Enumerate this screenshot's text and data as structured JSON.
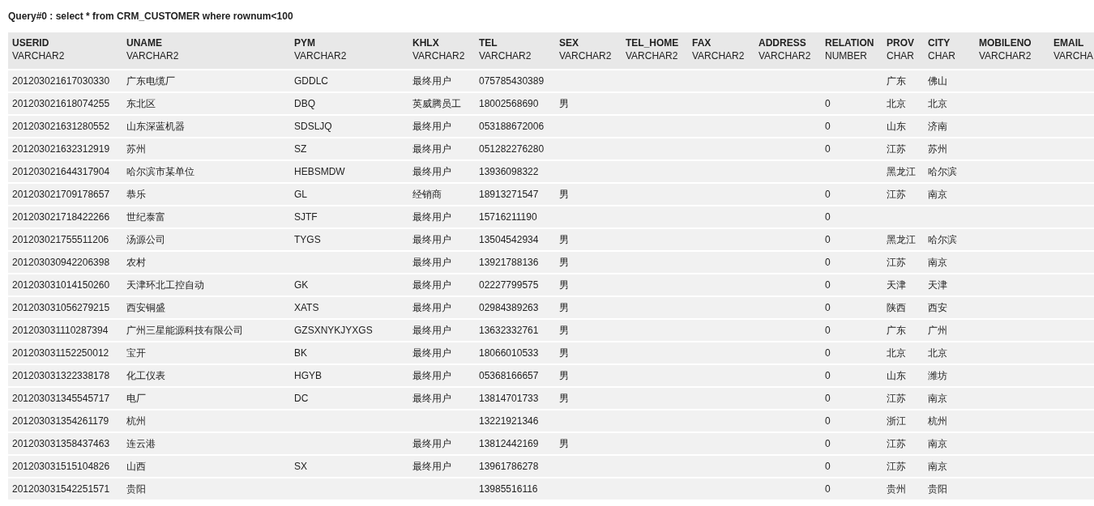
{
  "query_title": "Query#0 : select * from CRM_CUSTOMER where rownum<100",
  "table": {
    "columns": [
      {
        "name": "USERID",
        "type": "VARCHAR2"
      },
      {
        "name": "UNAME",
        "type": "VARCHAR2"
      },
      {
        "name": "PYM",
        "type": "VARCHAR2"
      },
      {
        "name": "KHLX",
        "type": "VARCHAR2"
      },
      {
        "name": "TEL",
        "type": "VARCHAR2"
      },
      {
        "name": "SEX",
        "type": "VARCHAR2"
      },
      {
        "name": "TEL_HOME",
        "type": "VARCHAR2"
      },
      {
        "name": "FAX",
        "type": "VARCHAR2"
      },
      {
        "name": "ADDRESS",
        "type": "VARCHAR2"
      },
      {
        "name": "RELATION",
        "type": "NUMBER"
      },
      {
        "name": "PROV",
        "type": "CHAR"
      },
      {
        "name": "CITY",
        "type": "CHAR"
      },
      {
        "name": "MOBILENO",
        "type": "VARCHAR2"
      },
      {
        "name": "EMAIL",
        "type": "VARCHA"
      }
    ],
    "rows": [
      {
        "userid": "201203021617030330",
        "uname": "广东电缆厂",
        "pym": "GDDLC",
        "khlx": "最终用户",
        "tel": "075785430389",
        "prov": "广东",
        "city": "佛山"
      },
      {
        "userid": "201203021618074255",
        "uname": "东北区",
        "pym": "DBQ",
        "khlx": "英威腾员工",
        "tel": "18002568690",
        "sex": "男",
        "relation": "0",
        "prov": "北京",
        "city": "北京"
      },
      {
        "userid": "201203021631280552",
        "uname": "山东深蓝机器",
        "pym": "SDSLJQ",
        "khlx": "最终用户",
        "tel": "053188672006",
        "relation": "0",
        "prov": "山东",
        "city": "济南"
      },
      {
        "userid": "201203021632312919",
        "uname": "苏州",
        "pym": "SZ",
        "khlx": "最终用户",
        "tel": "051282276280",
        "relation": "0",
        "prov": "江苏",
        "city": "苏州"
      },
      {
        "userid": "201203021644317904",
        "uname": "哈尔滨市某单位",
        "pym": "HEBSMDW",
        "khlx": "最终用户",
        "tel": "13936098322",
        "prov": "黑龙江",
        "city": "哈尔滨"
      },
      {
        "userid": "201203021709178657",
        "uname": "恭乐",
        "pym": "GL",
        "khlx": "经销商",
        "tel": "18913271547",
        "sex": "男",
        "relation": "0",
        "prov": "江苏",
        "city": "南京"
      },
      {
        "userid": "201203021718422266",
        "uname": "世纪泰富",
        "pym": "SJTF",
        "khlx": "最终用户",
        "tel": "15716211190",
        "relation": "0"
      },
      {
        "userid": "201203021755511206",
        "uname": "汤源公司",
        "pym": "TYGS",
        "khlx": "最终用户",
        "tel": "13504542934",
        "sex": "男",
        "relation": "0",
        "prov": "黑龙江",
        "city": "哈尔滨"
      },
      {
        "userid": "201203030942206398",
        "uname": "农村",
        "khlx": "最终用户",
        "tel": "13921788136",
        "sex": "男",
        "relation": "0",
        "prov": "江苏",
        "city": "南京"
      },
      {
        "userid": "201203031014150260",
        "uname": "天津环北工控自动",
        "pym": "GK",
        "khlx": "最终用户",
        "tel": "02227799575",
        "sex": "男",
        "relation": "0",
        "prov": "天津",
        "city": "天津"
      },
      {
        "userid": "201203031056279215",
        "uname": "西安铜盛",
        "pym": "XATS",
        "khlx": "最终用户",
        "tel": "02984389263",
        "sex": "男",
        "relation": "0",
        "prov": "陕西",
        "city": "西安"
      },
      {
        "userid": "201203031110287394",
        "uname": "广州三星能源科技有限公司",
        "pym": "GZSXNYKJYXGS",
        "khlx": "最终用户",
        "tel": "13632332761",
        "sex": "男",
        "relation": "0",
        "prov": "广东",
        "city": "广州"
      },
      {
        "userid": "201203031152250012",
        "uname": "宝开",
        "pym": "BK",
        "khlx": "最终用户",
        "tel": "18066010533",
        "sex": "男",
        "relation": "0",
        "prov": "北京",
        "city": "北京"
      },
      {
        "userid": "201203031322338178",
        "uname": "化工仪表",
        "pym": "HGYB",
        "khlx": "最终用户",
        "tel": "05368166657",
        "sex": "男",
        "relation": "0",
        "prov": "山东",
        "city": "潍坊"
      },
      {
        "userid": "201203031345545717",
        "uname": "电厂",
        "pym": "DC",
        "khlx": "最终用户",
        "tel": "13814701733",
        "sex": "男",
        "relation": "0",
        "prov": "江苏",
        "city": "南京"
      },
      {
        "userid": "201203031354261179",
        "uname": "杭州",
        "tel": "13221921346",
        "relation": "0",
        "prov": "浙江",
        "city": "杭州"
      },
      {
        "userid": "201203031358437463",
        "uname": "连云港",
        "khlx": "最终用户",
        "tel": "13812442169",
        "sex": "男",
        "relation": "0",
        "prov": "江苏",
        "city": "南京"
      },
      {
        "userid": "201203031515104826",
        "uname": "山西",
        "pym": "SX",
        "khlx": "最终用户",
        "tel": "13961786278",
        "relation": "0",
        "prov": "江苏",
        "city": "南京"
      },
      {
        "userid": "201203031542251571",
        "uname": "贵阳",
        "tel": "13985516116",
        "relation": "0",
        "prov": "贵州",
        "city": "贵阳"
      }
    ]
  }
}
